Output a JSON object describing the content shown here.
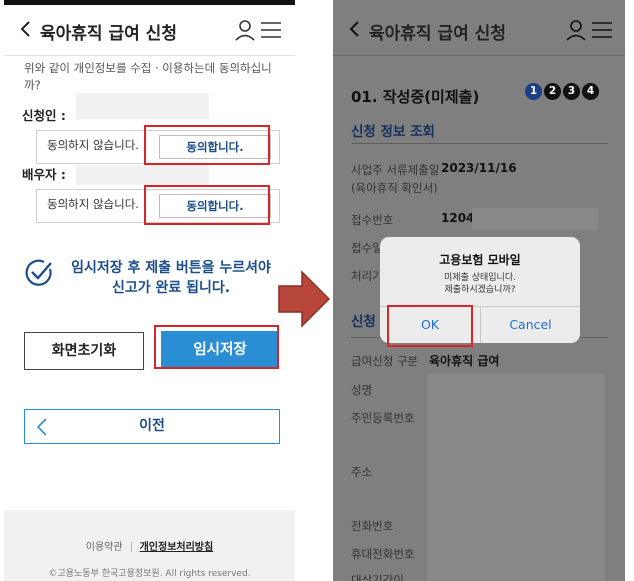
{
  "left_screen": {
    "header": {
      "title": "육아휴직 급여 신청"
    },
    "consent_text": "위와 같이 개인정보를 수집 · 이용하는데 동의하십니까?",
    "applicant": {
      "label": "신청인 :",
      "disagree": "동의하지 않습니다.",
      "agree": "동의합니다."
    },
    "spouse": {
      "label": "배우자 :",
      "disagree": "동의하지 않습니다.",
      "agree": "동의합니다."
    },
    "notice": "임시저장 후 제출 버튼을 누르셔야 신고가 완료 됩니다.",
    "buttons": {
      "reset": "화면초기화",
      "save": "임시저장",
      "prev": "이전"
    },
    "footer": {
      "terms": "이용약관",
      "privacy": "개인정보처리방침",
      "copyright": "©고용노동부 한국고용정보원. All rights reserved."
    }
  },
  "right_screen": {
    "header": {
      "title": "육아휴직 급여 신청"
    },
    "step_title": "01. 작성중(미제출)",
    "steps": [
      "1",
      "2",
      "3",
      "4"
    ],
    "section1": "신청 정보 조회",
    "submit_date_label_1": "사업주 서류제출일",
    "submit_date_label_2": "(육아휴직 확인서)",
    "submit_date_value": "2023/11/16",
    "receipt_no_label": "접수번호",
    "receipt_no_value": "1204",
    "receipt_date_label": "접수일",
    "process_label": "처리기",
    "section2": "신청",
    "benefit_type_label": "급여신청 구분",
    "benefit_type_value": "육아휴직 급여",
    "name_label": "성명",
    "rrn_label": "주민등록번호",
    "address_label": "주소",
    "phone_label": "전화번호",
    "mobile_label": "휴대전화번호",
    "last_label": "대상기간이"
  },
  "dialog": {
    "title": "고용보험 모바일",
    "message_1": "미제출 상태입니다.",
    "message_2": "제출하시겠습니까?",
    "ok": "OK",
    "cancel": "Cancel"
  },
  "colors": {
    "brand_blue": "#1d4e89",
    "accent_blue": "#2a8ed5",
    "highlight_red": "#d9252a",
    "arrow_red": "#b8463b"
  },
  "icons": [
    "chevron-left-icon",
    "user-icon",
    "hamburger-menu-icon",
    "check-circle-icon",
    "right-arrow-icon"
  ]
}
